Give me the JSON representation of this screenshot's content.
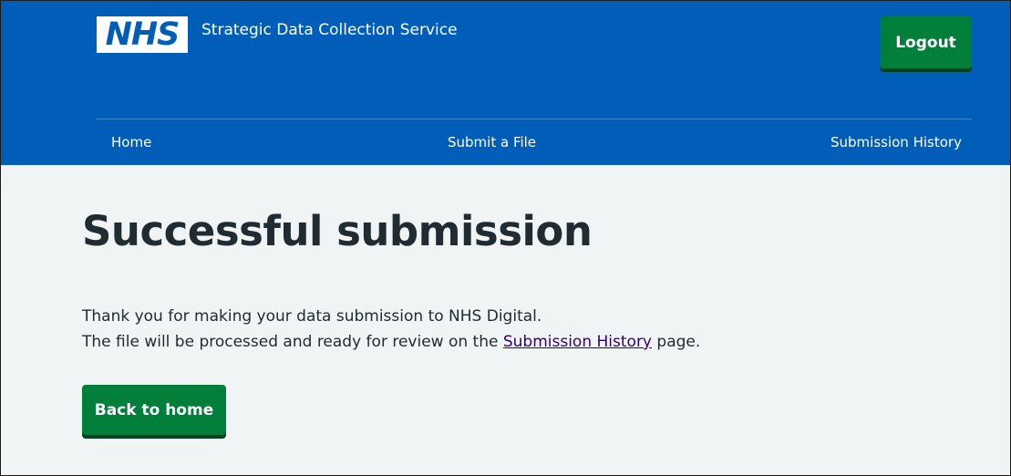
{
  "header": {
    "logo_text": "NHS",
    "service_name": "Strategic Data Collection Service",
    "logout_label": "Logout"
  },
  "nav": {
    "items": [
      {
        "label": "Home"
      },
      {
        "label": "Submit a File"
      },
      {
        "label": "Submission History"
      }
    ]
  },
  "main": {
    "title": "Successful submission",
    "paragraph_1": "Thank you for making your data submission to NHS Digital.",
    "paragraph_2_prefix": "The file will be processed and ready for review on the ",
    "paragraph_2_link": "Submission History",
    "paragraph_2_suffix": " page.",
    "back_button_label": "Back to home"
  },
  "colors": {
    "header_bg": "#005eb8",
    "button_green": "#007f3b",
    "page_bg": "#f0f4f5",
    "text": "#212b32",
    "link_visited": "#330072"
  }
}
